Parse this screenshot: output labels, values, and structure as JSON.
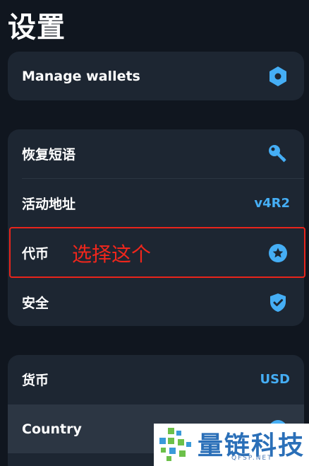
{
  "page": {
    "title": "设置"
  },
  "wallets_card": {
    "manage_wallets_label": "Manage wallets",
    "icon": "hexagon-icon"
  },
  "general_card": {
    "recovery_phrase_label": "恢复短语",
    "recovery_icon": "key-icon",
    "active_address_label": "活动地址",
    "active_address_value": "v4R2",
    "tokens_label": "代币",
    "tokens_icon": "star-icon",
    "security_label": "安全",
    "security_icon": "shield-check-icon"
  },
  "preferences_card": {
    "currency_label": "货币",
    "currency_value": "USD",
    "country_label": "Country",
    "country_icon": "globe-icon"
  },
  "annotation": {
    "text": "选择这个",
    "color": "#e8241b"
  },
  "watermark": {
    "brand": "量链科技",
    "domain": "QFSP.NET"
  },
  "colors": {
    "background": "#10161f",
    "card": "#1d2632",
    "accent": "#45aef5"
  }
}
